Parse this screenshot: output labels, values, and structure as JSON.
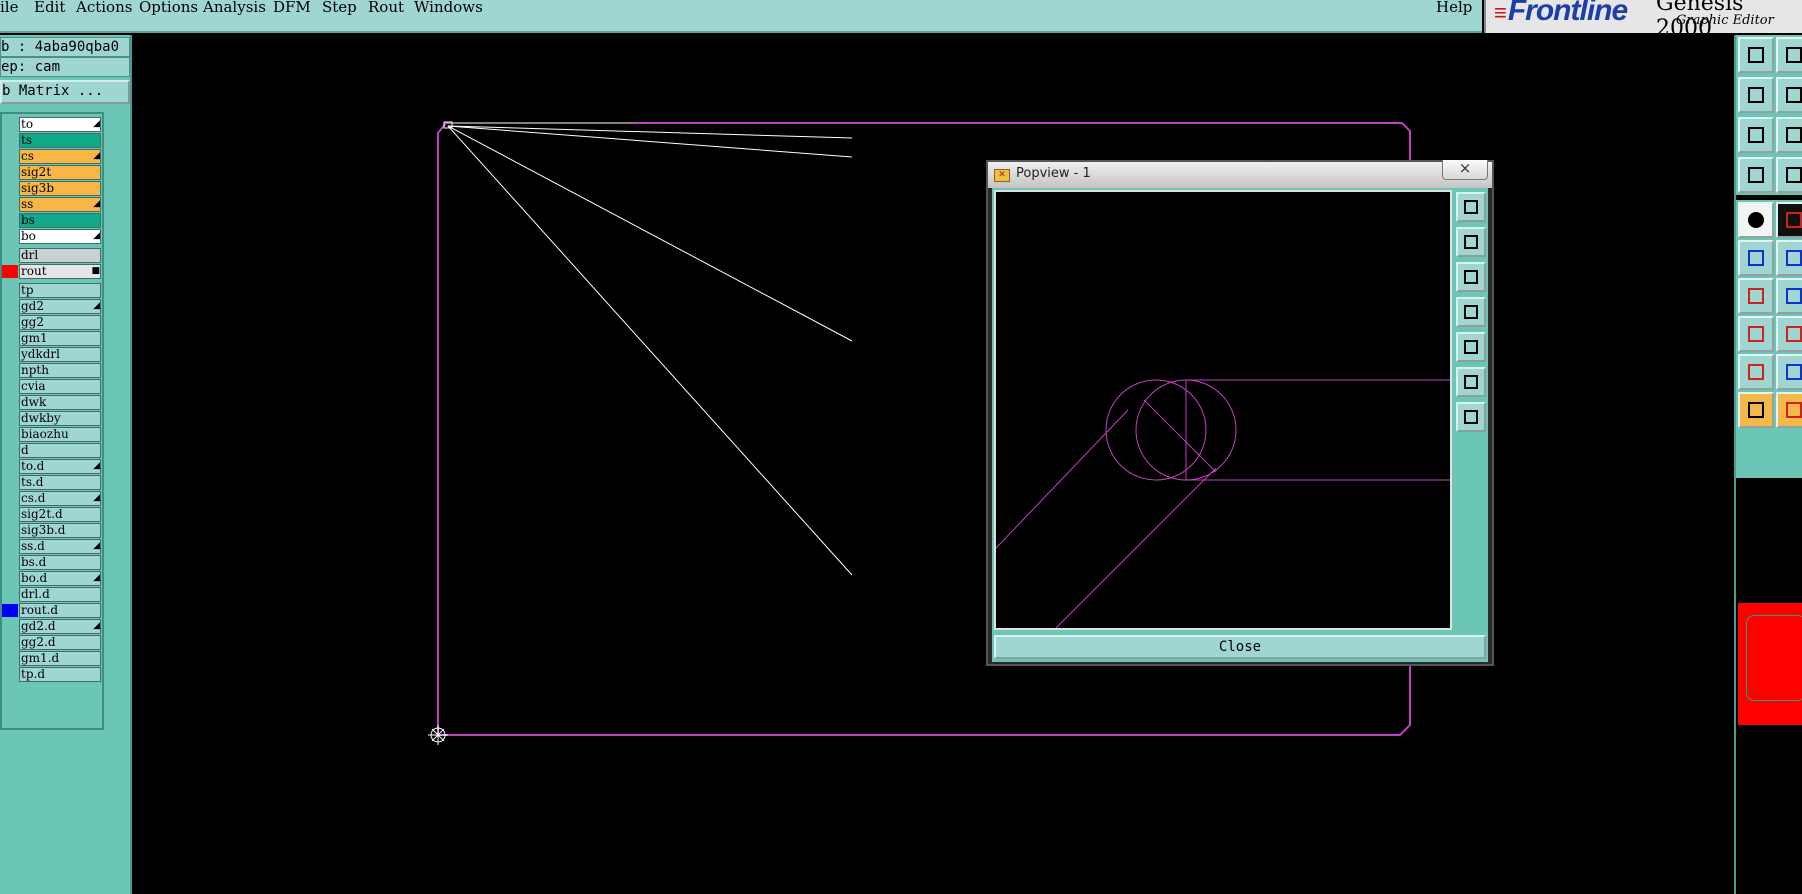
{
  "menubar": {
    "items": [
      {
        "label": "File",
        "shown": "ile"
      },
      {
        "label": "Edit"
      },
      {
        "label": "Actions"
      },
      {
        "label": "Options"
      },
      {
        "label": "Analysis"
      },
      {
        "label": "DFM"
      },
      {
        "label": "Step"
      },
      {
        "label": "Rout"
      },
      {
        "label": "Windows"
      }
    ],
    "help": "Help"
  },
  "brand": {
    "logo": "Frontline",
    "product": "Genesis 2000",
    "subtitle": "Graphic Editor"
  },
  "left": {
    "job": "b : 4aba90qba0",
    "step": "ep: cam",
    "matrix_button": "b Matrix ...",
    "layers": [
      {
        "name": "to",
        "fill": "#ffffff",
        "swatch": "#6cc6b6",
        "mark": "◢"
      },
      {
        "name": "ts",
        "fill": "#14a88a",
        "swatch": "#6cc6b6",
        "mark": ""
      },
      {
        "name": "cs",
        "fill": "#f7b646",
        "swatch": "#6cc6b6",
        "mark": "◢"
      },
      {
        "name": "sig2t",
        "fill": "#f7b646",
        "swatch": "#6cc6b6",
        "mark": ""
      },
      {
        "name": "sig3b",
        "fill": "#f7b646",
        "swatch": "#6cc6b6",
        "mark": ""
      },
      {
        "name": "ss",
        "fill": "#f7b646",
        "swatch": "#6cc6b6",
        "mark": "◢"
      },
      {
        "name": "bs",
        "fill": "#14a88a",
        "swatch": "#6cc6b6",
        "mark": ""
      },
      {
        "name": "bo",
        "fill": "#ffffff",
        "swatch": "#6cc6b6",
        "mark": "◢"
      },
      {
        "name": "drl",
        "fill": "#c8d2d2",
        "swatch": "#6cc6b6",
        "mark": "",
        "gap": true
      },
      {
        "name": "rout",
        "fill": "#e6e6e6",
        "swatch": "#ff0000",
        "mark": "■"
      },
      {
        "name": "tp",
        "fill": "#a0d6d2",
        "swatch": "#6cc6b6",
        "mark": "",
        "gap": true
      },
      {
        "name": "gd2",
        "fill": "#a0d6d2",
        "swatch": "#6cc6b6",
        "mark": "◢"
      },
      {
        "name": "gg2",
        "fill": "#a0d6d2",
        "swatch": "#6cc6b6",
        "mark": ""
      },
      {
        "name": "gm1",
        "fill": "#a0d6d2",
        "swatch": "#6cc6b6",
        "mark": ""
      },
      {
        "name": "ydkdrl",
        "fill": "#a0d6d2",
        "swatch": "#6cc6b6",
        "mark": ""
      },
      {
        "name": "npth",
        "fill": "#a0d6d2",
        "swatch": "#6cc6b6",
        "mark": ""
      },
      {
        "name": "cvia",
        "fill": "#a0d6d2",
        "swatch": "#6cc6b6",
        "mark": ""
      },
      {
        "name": "dwk",
        "fill": "#a0d6d2",
        "swatch": "#6cc6b6",
        "mark": ""
      },
      {
        "name": "dwkby",
        "fill": "#a0d6d2",
        "swatch": "#6cc6b6",
        "mark": ""
      },
      {
        "name": "biaozhu",
        "fill": "#a0d6d2",
        "swatch": "#6cc6b6",
        "mark": ""
      },
      {
        "name": "d",
        "fill": "#a0d6d2",
        "swatch": "#6cc6b6",
        "mark": ""
      },
      {
        "name": "to.d",
        "fill": "#a0d6d2",
        "swatch": "#6cc6b6",
        "mark": "◢"
      },
      {
        "name": "ts.d",
        "fill": "#a0d6d2",
        "swatch": "#6cc6b6",
        "mark": ""
      },
      {
        "name": "cs.d",
        "fill": "#a0d6d2",
        "swatch": "#6cc6b6",
        "mark": "◢"
      },
      {
        "name": "sig2t.d",
        "fill": "#a0d6d2",
        "swatch": "#6cc6b6",
        "mark": ""
      },
      {
        "name": "sig3b.d",
        "fill": "#a0d6d2",
        "swatch": "#6cc6b6",
        "mark": ""
      },
      {
        "name": "ss.d",
        "fill": "#a0d6d2",
        "swatch": "#6cc6b6",
        "mark": "◢"
      },
      {
        "name": "bs.d",
        "fill": "#a0d6d2",
        "swatch": "#6cc6b6",
        "mark": ""
      },
      {
        "name": "bo.d",
        "fill": "#a0d6d2",
        "swatch": "#6cc6b6",
        "mark": "◢"
      },
      {
        "name": "drl.d",
        "fill": "#a0d6d2",
        "swatch": "#6cc6b6",
        "mark": ""
      },
      {
        "name": "rout.d",
        "fill": "#a0d6d2",
        "swatch": "#0000ff",
        "mark": ""
      },
      {
        "name": "gd2.d",
        "fill": "#a0d6d2",
        "swatch": "#6cc6b6",
        "mark": "◢"
      },
      {
        "name": "gg2.d",
        "fill": "#a0d6d2",
        "swatch": "#6cc6b6",
        "mark": ""
      },
      {
        "name": "gm1.d",
        "fill": "#a0d6d2",
        "swatch": "#6cc6b6",
        "mark": ""
      },
      {
        "name": "tp.d",
        "fill": "#a0d6d2",
        "swatch": "#6cc6b6",
        "mark": ""
      }
    ]
  },
  "popview": {
    "title": "Popview - 1",
    "close_glyph": "×",
    "close_button": "Close",
    "tools": [
      "zoom-home-icon",
      "pan-up-icon",
      "pan-down-icon",
      "pan-left-icon",
      "pan-right-icon",
      "zoom-fit-icon",
      "zoom-selection-icon"
    ]
  },
  "colors": {
    "panel": "#6cc6b6",
    "panel_light": "#a0d6d2",
    "board_outline": "#c040c0",
    "rout_line": "#ffffff"
  },
  "right_toolbar": {
    "icons": [
      "copy-icon",
      "snapshot-icon",
      "zoom-in-icon",
      "zoom-out-icon",
      "fit-icon",
      "stretch-icon",
      "measure-icon",
      "grid-icon",
      "feature-icon",
      "color-icon",
      "connect-icon",
      "cross-icon",
      "line-icon",
      "line-angle-icon",
      "pad-icon",
      "dash-icon",
      "triangle-icon",
      "arrow-triangle-icon",
      "select-pointer-icon",
      "select-red-icon"
    ]
  }
}
